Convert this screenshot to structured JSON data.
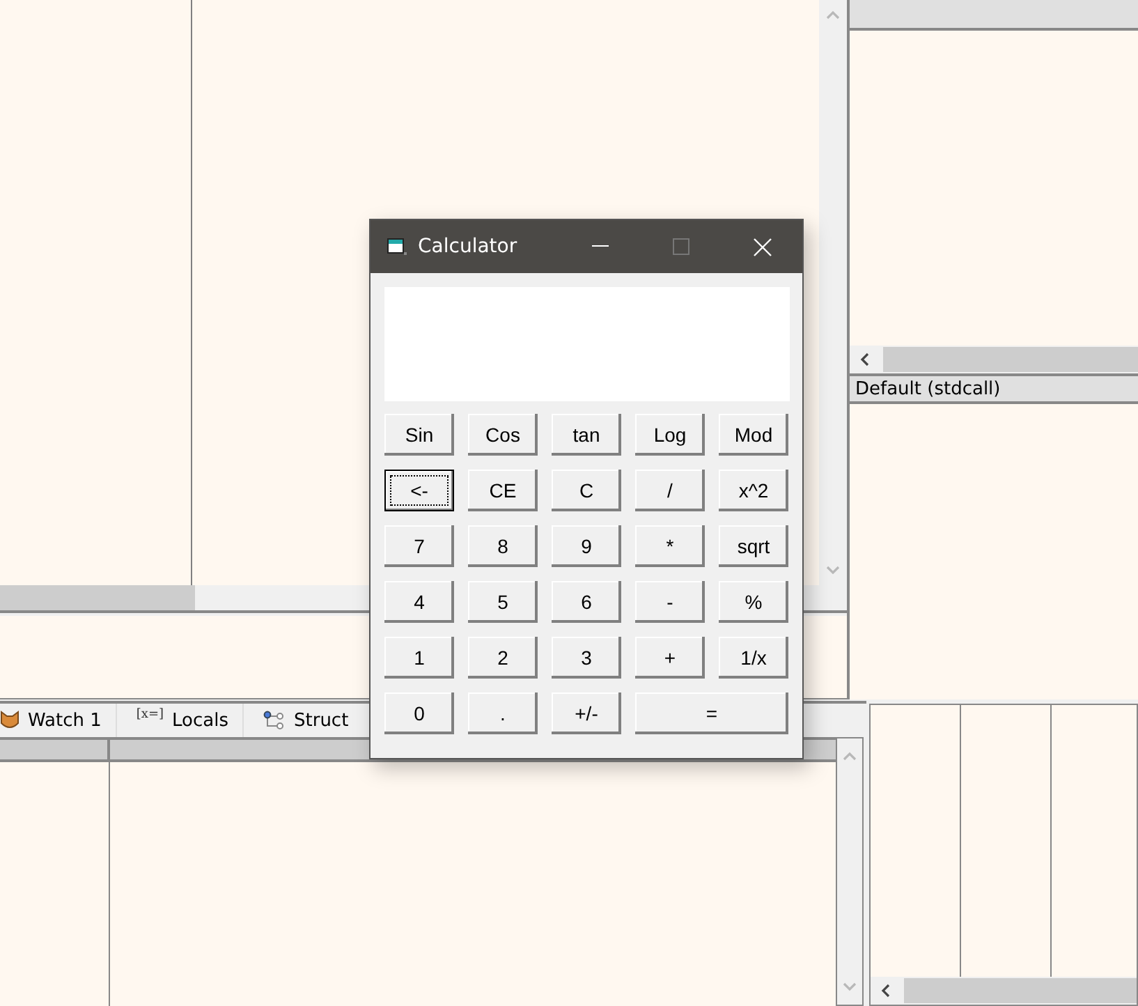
{
  "right_panel": {
    "call_convention": "Default (stdcall)"
  },
  "bottom_tabs": [
    {
      "kind": "watch",
      "label": "Watch 1"
    },
    {
      "kind": "locals",
      "icon_text": "[x=]",
      "label": "Locals"
    },
    {
      "kind": "struct",
      "label": "Struct"
    }
  ],
  "calculator": {
    "title": "Calculator",
    "buttons": [
      {
        "label": "Sin",
        "kind": "normal",
        "focused": false
      },
      {
        "label": "Cos",
        "kind": "normal",
        "focused": false
      },
      {
        "label": "tan",
        "kind": "normal",
        "focused": false
      },
      {
        "label": "Log",
        "kind": "normal",
        "focused": false
      },
      {
        "label": "Mod",
        "kind": "normal",
        "focused": false
      },
      {
        "label": "<-",
        "kind": "normal",
        "focused": true
      },
      {
        "label": "CE",
        "kind": "normal",
        "focused": false
      },
      {
        "label": "C",
        "kind": "normal",
        "focused": false
      },
      {
        "label": "/",
        "kind": "normal",
        "focused": false
      },
      {
        "label": "x^2",
        "kind": "normal",
        "focused": false
      },
      {
        "label": "7",
        "kind": "normal",
        "focused": false
      },
      {
        "label": "8",
        "kind": "normal",
        "focused": false
      },
      {
        "label": "9",
        "kind": "normal",
        "focused": false
      },
      {
        "label": "*",
        "kind": "normal",
        "focused": false
      },
      {
        "label": "sqrt",
        "kind": "normal",
        "focused": false
      },
      {
        "label": "4",
        "kind": "normal",
        "focused": false
      },
      {
        "label": "5",
        "kind": "normal",
        "focused": false
      },
      {
        "label": "6",
        "kind": "normal",
        "focused": false
      },
      {
        "label": "-",
        "kind": "normal",
        "focused": false
      },
      {
        "label": "%",
        "kind": "normal",
        "focused": false
      },
      {
        "label": "1",
        "kind": "normal",
        "focused": false
      },
      {
        "label": "2",
        "kind": "normal",
        "focused": false
      },
      {
        "label": "3",
        "kind": "normal",
        "focused": false
      },
      {
        "label": "+",
        "kind": "normal",
        "focused": false
      },
      {
        "label": "1/x",
        "kind": "normal",
        "focused": false
      },
      {
        "label": "0",
        "kind": "normal",
        "focused": false
      },
      {
        "label": ".",
        "kind": "normal",
        "focused": false
      },
      {
        "label": "+/-",
        "kind": "normal",
        "focused": false
      },
      {
        "label": "=",
        "kind": "wide",
        "focused": false
      }
    ]
  }
}
